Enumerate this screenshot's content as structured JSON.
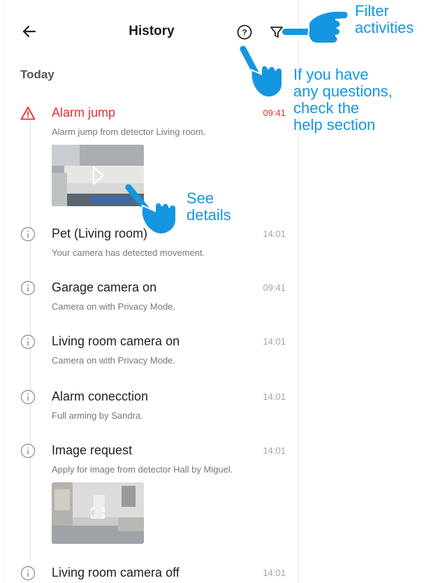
{
  "header": {
    "title": "History"
  },
  "section": {
    "label": "Today"
  },
  "events": [
    {
      "title": "Alarm jump",
      "time": "09:41",
      "description": "Alarm jump from detector Living room."
    },
    {
      "title": "Pet (Living room)",
      "time": "14:01",
      "description": "Your camera has detected movement."
    },
    {
      "title": "Garage camera on",
      "time": "09:41",
      "description": "Camera on with Privacy Mode."
    },
    {
      "title": "Living room camera on",
      "time": "14:01",
      "description": "Camera on with Privacy Mode."
    },
    {
      "title": "Alarm conecction",
      "time": "14:01",
      "description": "Full arming by Sandra."
    },
    {
      "title": "Image request",
      "time": "14:01",
      "description": "Apply for image from detector Hall by Miguel."
    },
    {
      "title": "Living room camera off",
      "time": "14:01",
      "description": ""
    }
  ],
  "annotations": {
    "filter": [
      "Filter",
      "activities"
    ],
    "help": [
      "If you have",
      "any questions,",
      "check the",
      "help section"
    ],
    "details": [
      "See",
      "details"
    ]
  },
  "colors": {
    "accent": "#1496e0",
    "alarm": "#e5312e",
    "muted": "#a5a5a5"
  },
  "icons": [
    "back-arrow-icon",
    "help-icon",
    "filter-icon",
    "warning-icon",
    "info-icon",
    "play-icon",
    "expand-icon",
    "pointing-hand-icon"
  ]
}
